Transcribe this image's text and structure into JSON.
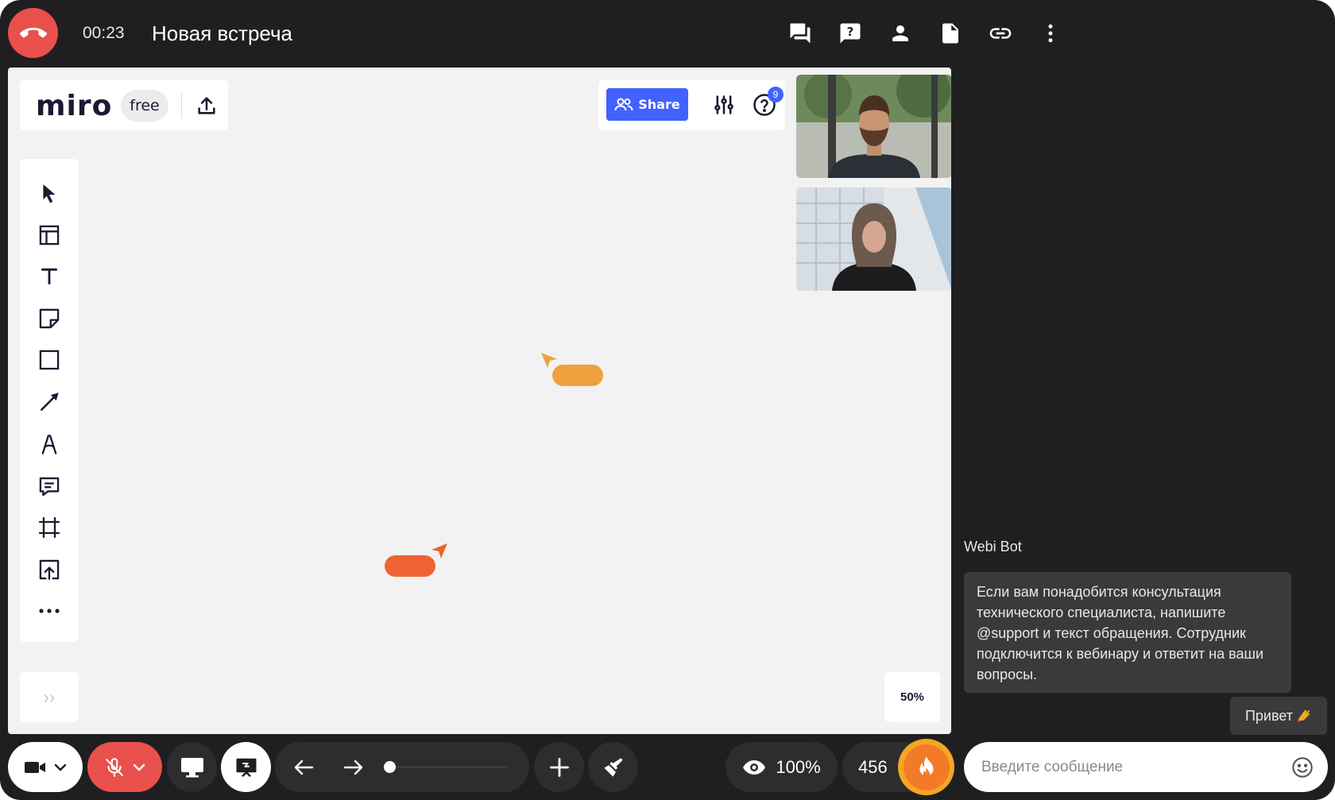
{
  "header": {
    "timer": "00:23",
    "title": "Новая встреча",
    "icons": [
      "chat-icon",
      "question-icon",
      "participants-icon",
      "document-icon",
      "link-icon",
      "more-vertical-icon"
    ]
  },
  "board": {
    "logo": "miro",
    "plan_badge": "free",
    "share_label": "Share",
    "help_badge_count": "9",
    "zoom_label": "50%",
    "tools": [
      "select-icon",
      "templates-icon",
      "text-icon",
      "sticky-note-icon",
      "shape-icon",
      "arrow-line-icon",
      "pen-icon",
      "comment-icon",
      "frame-icon",
      "upload-tool-icon",
      "more-tools-icon"
    ],
    "expand_label": "››",
    "cursor_colors": [
      "#f0a03c",
      "#ee6331"
    ]
  },
  "chat": {
    "sender": "Webi Bot",
    "message": "Если вам понадобится консультация технического специалиста, напишите @support и текст обращения. Сотрудник подключится к вебинару и ответит на ваши вопросы.",
    "reply": "Привет",
    "input_placeholder": "Введите сообщение"
  },
  "controls": {
    "volume_label": "100%",
    "viewer_count": "456"
  },
  "colors": {
    "end_call": "#e9504b",
    "mic_muted": "#e9504b",
    "share_blue": "#4262ff",
    "fire": "#f5a623",
    "background": "#1f1f21"
  }
}
